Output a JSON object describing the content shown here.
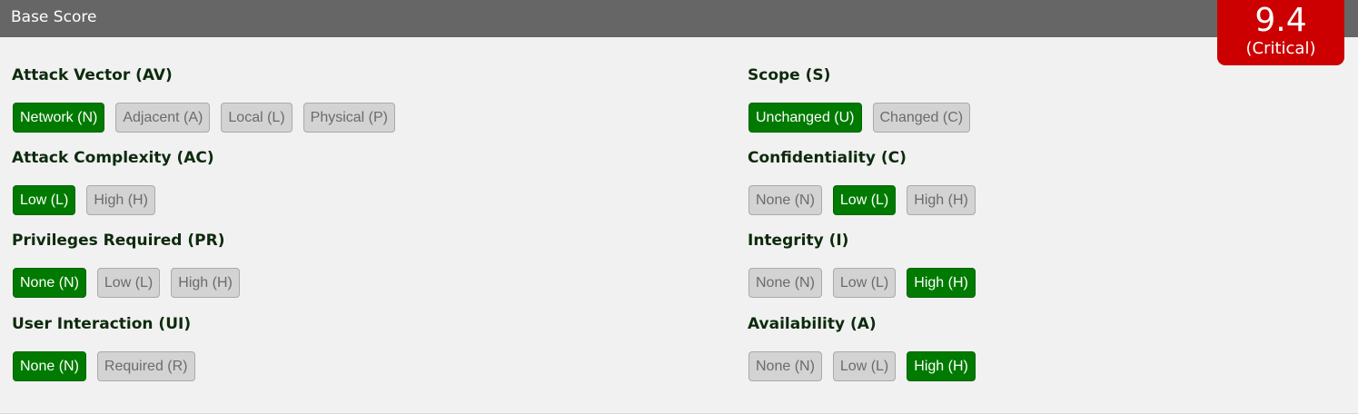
{
  "header": {
    "title": "Base Score"
  },
  "score": {
    "value": "9.4",
    "severity": "(Critical)"
  },
  "metrics": {
    "av": {
      "title": "Attack Vector (AV)",
      "options": [
        {
          "label": "Network (N)",
          "selected": true
        },
        {
          "label": "Adjacent (A)",
          "selected": false
        },
        {
          "label": "Local (L)",
          "selected": false
        },
        {
          "label": "Physical (P)",
          "selected": false
        }
      ]
    },
    "ac": {
      "title": "Attack Complexity (AC)",
      "options": [
        {
          "label": "Low (L)",
          "selected": true
        },
        {
          "label": "High (H)",
          "selected": false
        }
      ]
    },
    "pr": {
      "title": "Privileges Required (PR)",
      "options": [
        {
          "label": "None (N)",
          "selected": true
        },
        {
          "label": "Low (L)",
          "selected": false
        },
        {
          "label": "High (H)",
          "selected": false
        }
      ]
    },
    "ui": {
      "title": "User Interaction (UI)",
      "options": [
        {
          "label": "None (N)",
          "selected": true
        },
        {
          "label": "Required (R)",
          "selected": false
        }
      ]
    },
    "s": {
      "title": "Scope (S)",
      "options": [
        {
          "label": "Unchanged (U)",
          "selected": true
        },
        {
          "label": "Changed (C)",
          "selected": false
        }
      ]
    },
    "c": {
      "title": "Confidentiality (C)",
      "options": [
        {
          "label": "None (N)",
          "selected": false
        },
        {
          "label": "Low (L)",
          "selected": true
        },
        {
          "label": "High (H)",
          "selected": false
        }
      ]
    },
    "i": {
      "title": "Integrity (I)",
      "options": [
        {
          "label": "None (N)",
          "selected": false
        },
        {
          "label": "Low (L)",
          "selected": false
        },
        {
          "label": "High (H)",
          "selected": true
        }
      ]
    },
    "a": {
      "title": "Availability (A)",
      "options": [
        {
          "label": "None (N)",
          "selected": false
        },
        {
          "label": "Low (L)",
          "selected": false
        },
        {
          "label": "High (H)",
          "selected": true
        }
      ]
    }
  }
}
